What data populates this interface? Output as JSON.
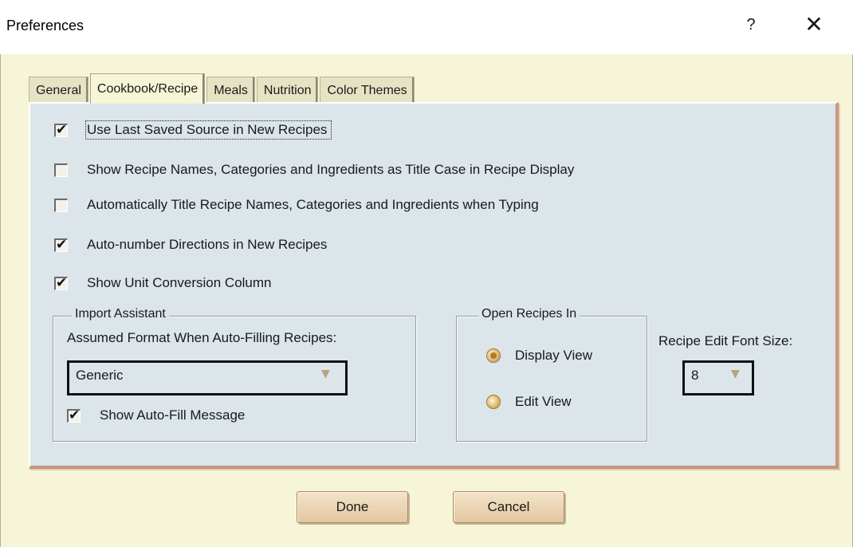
{
  "window": {
    "title": "Preferences",
    "help_label": "?",
    "close_label": "✕"
  },
  "tabs": [
    {
      "label": "General",
      "active": false
    },
    {
      "label": "Cookbook/Recipe",
      "active": true
    },
    {
      "label": "Meals",
      "active": false
    },
    {
      "label": "Nutrition",
      "active": false
    },
    {
      "label": "Color Themes",
      "active": false
    }
  ],
  "options": [
    {
      "label": "Use Last Saved Source in New Recipes",
      "checked": true
    },
    {
      "label": "Show Recipe Names, Categories and Ingredients as Title Case in Recipe Display",
      "checked": false
    },
    {
      "label": "Automatically Title Recipe Names, Categories and Ingredients when Typing",
      "checked": false
    },
    {
      "label": "Auto-number Directions in New Recipes",
      "checked": true
    },
    {
      "label": "Show Unit Conversion Column",
      "checked": true
    }
  ],
  "import_assistant": {
    "legend": "Import Assistant",
    "format_label": "Assumed Format When Auto-Filling Recipes:",
    "format_value": "Generic",
    "show_message_label": "Show Auto-Fill Message",
    "show_message_checked": true
  },
  "open_recipes": {
    "legend": "Open Recipes In",
    "options": [
      {
        "label": "Display View",
        "selected": true
      },
      {
        "label": "Edit View",
        "selected": false
      }
    ]
  },
  "font_size": {
    "label": "Recipe Edit Font Size:",
    "value": "8"
  },
  "buttons": {
    "done": "Done",
    "cancel": "Cancel"
  },
  "colors": {
    "panel_bg": "#dbe5ea",
    "dialog_bg": "#f7f5d8",
    "accent_border": "#c6967f"
  },
  "icons": {
    "dropdown_arrow": "triangle-down",
    "check": "check-mark"
  }
}
